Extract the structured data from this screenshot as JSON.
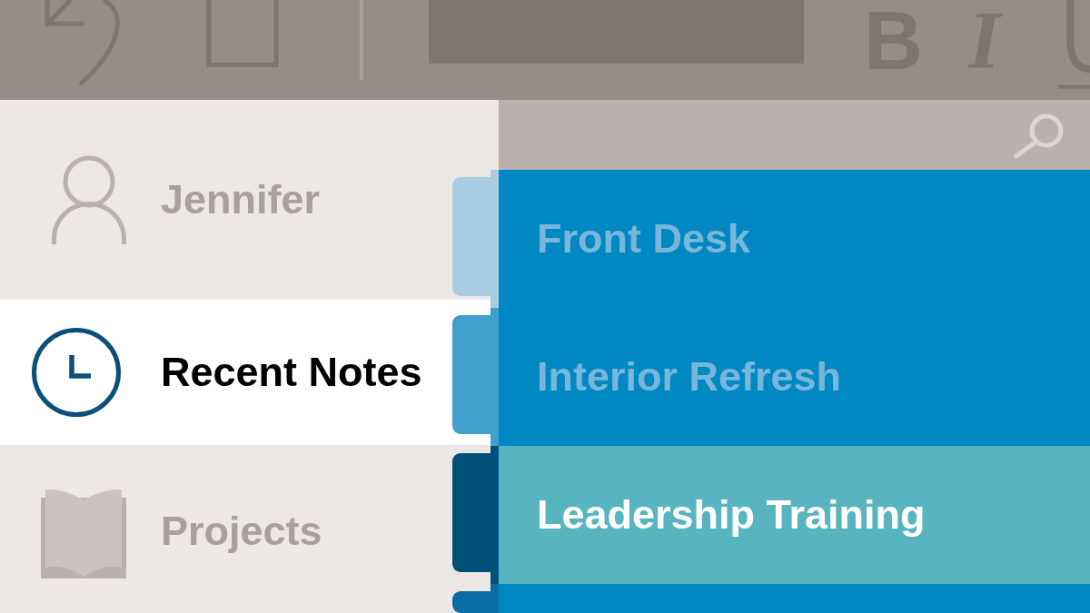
{
  "toolbar": {
    "format_buttons": [
      {
        "label": "B",
        "kind": "bold"
      },
      {
        "label": "I",
        "kind": "italic"
      }
    ]
  },
  "sidebar": {
    "items": [
      {
        "label": "Jennifer",
        "kind": "account",
        "selected": false
      },
      {
        "label": "Recent Notes",
        "kind": "recent",
        "selected": true
      },
      {
        "label": "Projects",
        "kind": "notebook",
        "selected": false
      }
    ]
  },
  "sections": [
    {
      "title": "Front Desk",
      "color": "#a8cce2",
      "selected": false
    },
    {
      "title": "Interior Refresh",
      "color": "#409fcd",
      "selected": false
    },
    {
      "title": "Leadership Training",
      "color": "#005179",
      "selected": true
    },
    {
      "color": "#0a6ca4",
      "selected": false
    }
  ]
}
